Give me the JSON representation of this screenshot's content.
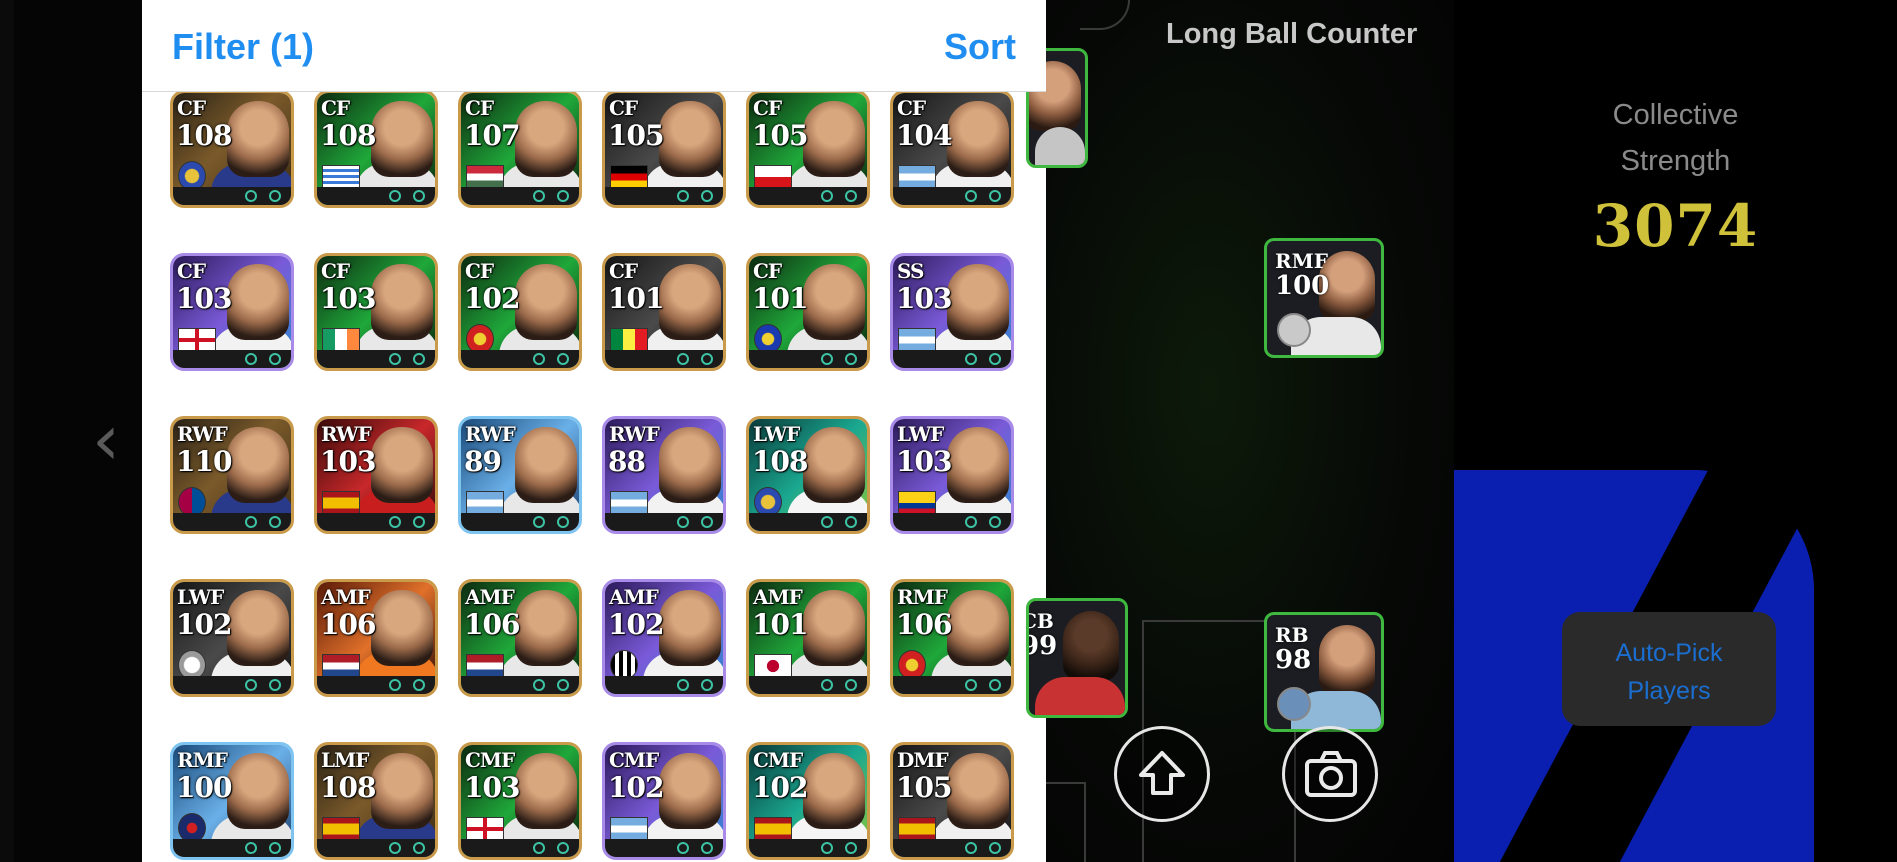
{
  "panel": {
    "filter_label": "Filter (1)",
    "sort_label": "Sort",
    "accent": "#1f8ef0"
  },
  "cards": [
    {
      "pos": "CF",
      "ovr": "108",
      "bg": "gold",
      "flag": "club"
    },
    {
      "pos": "CF",
      "ovr": "108",
      "bg": "green",
      "flag": "uruguay"
    },
    {
      "pos": "CF",
      "ovr": "107",
      "bg": "green",
      "flag": "hungary"
    },
    {
      "pos": "CF",
      "ovr": "105",
      "bg": "dark",
      "flag": "germany"
    },
    {
      "pos": "CF",
      "ovr": "105",
      "bg": "green",
      "flag": "czech"
    },
    {
      "pos": "CF",
      "ovr": "104",
      "bg": "dark",
      "flag": "argentina"
    },
    {
      "pos": "CF",
      "ovr": "103",
      "bg": "purple",
      "flag": "england"
    },
    {
      "pos": "CF",
      "ovr": "103",
      "bg": "green",
      "flag": "ireland"
    },
    {
      "pos": "CF",
      "ovr": "102",
      "bg": "green",
      "flag": "club-red"
    },
    {
      "pos": "CF",
      "ovr": "101",
      "bg": "dark",
      "flag": "senegal"
    },
    {
      "pos": "CF",
      "ovr": "101",
      "bg": "green",
      "flag": "club-blue"
    },
    {
      "pos": "SS",
      "ovr": "103",
      "bg": "purple",
      "flag": "argentina"
    },
    {
      "pos": "RWF",
      "ovr": "110",
      "bg": "gold",
      "flag": "club-fcb"
    },
    {
      "pos": "RWF",
      "ovr": "103",
      "bg": "red",
      "flag": "spain"
    },
    {
      "pos": "RWF",
      "ovr": "89",
      "bg": "blue",
      "flag": "argentina"
    },
    {
      "pos": "RWF",
      "ovr": "88",
      "bg": "purple",
      "flag": "argentina"
    },
    {
      "pos": "LWF",
      "ovr": "108",
      "bg": "teal",
      "flag": "club"
    },
    {
      "pos": "LWF",
      "ovr": "103",
      "bg": "purple",
      "flag": "colombia"
    },
    {
      "pos": "LWF",
      "ovr": "102",
      "bg": "dark",
      "flag": "club-white"
    },
    {
      "pos": "AMF",
      "ovr": "106",
      "bg": "orange",
      "flag": "netherlands"
    },
    {
      "pos": "AMF",
      "ovr": "106",
      "bg": "green",
      "flag": "netherlands"
    },
    {
      "pos": "AMF",
      "ovr": "102",
      "bg": "purple",
      "flag": "club-santos"
    },
    {
      "pos": "AMF",
      "ovr": "101",
      "bg": "green",
      "flag": "japan"
    },
    {
      "pos": "RMF",
      "ovr": "106",
      "bg": "green",
      "flag": "club-red"
    },
    {
      "pos": "RMF",
      "ovr": "100",
      "bg": "blue",
      "flag": "club-navy"
    },
    {
      "pos": "LMF",
      "ovr": "108",
      "bg": "gold",
      "flag": "spain"
    },
    {
      "pos": "CMF",
      "ovr": "103",
      "bg": "green",
      "flag": "england"
    },
    {
      "pos": "CMF",
      "ovr": "102",
      "bg": "purple",
      "flag": "argentina"
    },
    {
      "pos": "CMF",
      "ovr": "102",
      "bg": "teal",
      "flag": "spain"
    },
    {
      "pos": "DMF",
      "ovr": "105",
      "bg": "dark",
      "flag": "spain"
    }
  ],
  "pitch": {
    "title": "Long Ball Counter",
    "players": [
      {
        "pos": "RMF",
        "ovr": "100"
      },
      {
        "pos": "RB",
        "ovr": "98"
      },
      {
        "pos": "CB",
        "ovr": "99"
      }
    ],
    "buttons": {
      "upload": "upload-icon",
      "screenshot": "camera-icon"
    }
  },
  "side": {
    "strength_label": "Collective Strength",
    "strength_label_line1": "Collective",
    "strength_label_line2": "Strength",
    "strength_value": "3074",
    "autopick_line1": "Auto-Pick",
    "autopick_line2": "Players"
  }
}
